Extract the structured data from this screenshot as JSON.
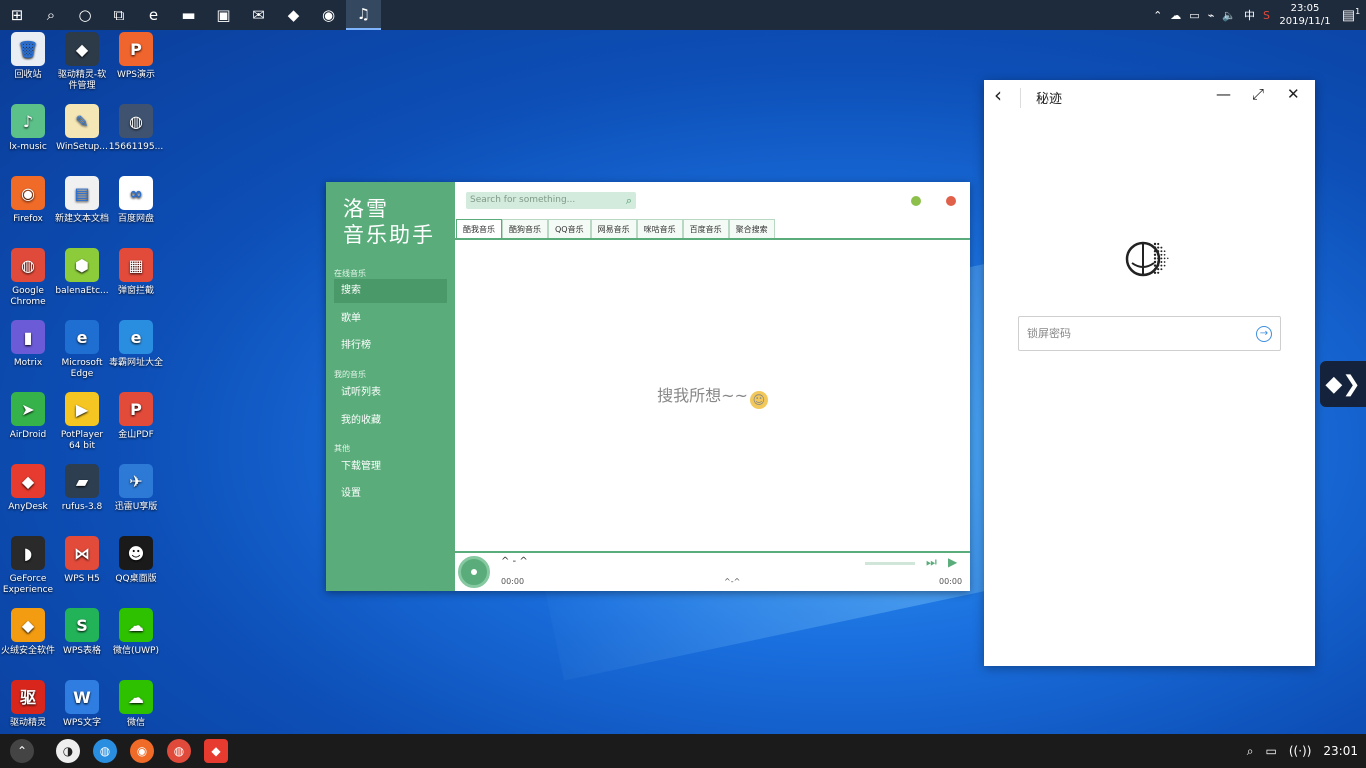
{
  "taskbar": {
    "buttons": [
      {
        "name": "start-icon",
        "glyph": "⊞"
      },
      {
        "name": "search-icon",
        "glyph": "⌕"
      },
      {
        "name": "cortana-icon",
        "glyph": "○"
      },
      {
        "name": "task-view-icon",
        "glyph": "⧉"
      },
      {
        "name": "edge-icon",
        "glyph": "e"
      },
      {
        "name": "file-explorer-icon",
        "glyph": "▬"
      },
      {
        "name": "store-icon",
        "glyph": "▣"
      },
      {
        "name": "mail-icon",
        "glyph": "✉"
      },
      {
        "name": "anydesk-icon",
        "glyph": "◆"
      },
      {
        "name": "firefox-icon",
        "glyph": "◉"
      },
      {
        "name": "luoxue-music-icon",
        "glyph": "♫"
      }
    ],
    "tray": {
      "ime": "中",
      "time": "23:05",
      "date": "2019/11/1",
      "notification_count": "1"
    }
  },
  "desktop_icons": [
    {
      "label": "回收站",
      "color": "#e9eef4",
      "glyph": "🗑",
      "col": 0,
      "row": 0
    },
    {
      "label": "驱动精灵-软件管理",
      "color": "#2d3a48",
      "glyph": "◆",
      "col": 1,
      "row": 0
    },
    {
      "label": "WPS演示",
      "color": "#f0642d",
      "glyph": "P",
      "col": 2,
      "row": 0
    },
    {
      "label": "lx-music",
      "color": "#5cc089",
      "glyph": "♪",
      "col": 0,
      "row": 1
    },
    {
      "label": "WinSetup...",
      "color": "#f4e6b5",
      "glyph": "✎",
      "col": 1,
      "row": 1
    },
    {
      "label": "15661195...",
      "color": "#3f5370",
      "glyph": "◍",
      "col": 2,
      "row": 1
    },
    {
      "label": "Firefox",
      "color": "#f06a28",
      "glyph": "◉",
      "col": 0,
      "row": 2
    },
    {
      "label": "新建文本文档",
      "color": "#f1f1f1",
      "glyph": "▤",
      "col": 1,
      "row": 2
    },
    {
      "label": "百度网盘",
      "color": "#ffffff",
      "glyph": "∞",
      "col": 2,
      "row": 2
    },
    {
      "label": "Google Chrome",
      "color": "#e04a3a",
      "glyph": "◍",
      "col": 0,
      "row": 3
    },
    {
      "label": "balenaEtc...",
      "color": "#8ccc3a",
      "glyph": "⬢",
      "col": 1,
      "row": 3
    },
    {
      "label": "弹窗拦截",
      "color": "#e24a3a",
      "glyph": "▦",
      "col": 2,
      "row": 3
    },
    {
      "label": "Motrix",
      "color": "#6c5bd6",
      "glyph": "▮",
      "col": 0,
      "row": 4
    },
    {
      "label": "Microsoft Edge",
      "color": "#1e6fd1",
      "glyph": "e",
      "col": 1,
      "row": 4
    },
    {
      "label": "毒霸网址大全",
      "color": "#2a8ee0",
      "glyph": "e",
      "col": 2,
      "row": 4
    },
    {
      "label": "AirDroid",
      "color": "#35b34a",
      "glyph": "➤",
      "col": 0,
      "row": 5
    },
    {
      "label": "PotPlayer 64 bit",
      "color": "#f5c521",
      "glyph": "▶",
      "col": 1,
      "row": 5
    },
    {
      "label": "金山PDF",
      "color": "#e24a3a",
      "glyph": "P",
      "col": 2,
      "row": 5
    },
    {
      "label": "AnyDesk",
      "color": "#e63b2e",
      "glyph": "◆",
      "col": 0,
      "row": 6
    },
    {
      "label": "rufus-3.8",
      "color": "#2c3e50",
      "glyph": "▰",
      "col": 1,
      "row": 6
    },
    {
      "label": "迅雷U享版",
      "color": "#2c7ad6",
      "glyph": "✈",
      "col": 2,
      "row": 6
    },
    {
      "label": "GeForce Experience",
      "color": "#2a2a2a",
      "glyph": "◗",
      "col": 0,
      "row": 7
    },
    {
      "label": "WPS H5",
      "color": "#e24a3a",
      "glyph": "⋈",
      "col": 1,
      "row": 7
    },
    {
      "label": "QQ桌面版",
      "color": "#1a1a1a",
      "glyph": "☻",
      "col": 2,
      "row": 7
    },
    {
      "label": "火绒安全软件",
      "color": "#f39c12",
      "glyph": "◆",
      "col": 0,
      "row": 8
    },
    {
      "label": "WPS表格",
      "color": "#22b358",
      "glyph": "S",
      "col": 1,
      "row": 8
    },
    {
      "label": "微信(UWP)",
      "color": "#2dc100",
      "glyph": "☁",
      "col": 2,
      "row": 8
    },
    {
      "label": "驱动精灵",
      "color": "#d9261c",
      "glyph": "驱",
      "col": 0,
      "row": 9
    },
    {
      "label": "WPS文字",
      "color": "#2f7de1",
      "glyph": "W",
      "col": 1,
      "row": 9
    },
    {
      "label": "微信",
      "color": "#2dc100",
      "glyph": "☁",
      "col": 2,
      "row": 9
    }
  ],
  "music_app": {
    "logo_line1": "洛雪",
    "logo_line2": "音乐助手",
    "sections": {
      "online": "在线音乐",
      "mine": "我的音乐",
      "other": "其他"
    },
    "menu": {
      "search": "搜索",
      "playlist": "歌单",
      "charts": "排行榜",
      "listen": "试听列表",
      "favorites": "我的收藏",
      "downloads": "下载管理",
      "settings": "设置"
    },
    "search_placeholder": "Search for something...",
    "tabs": [
      "酷我音乐",
      "酷狗音乐",
      "QQ音乐",
      "网易音乐",
      "咪咕音乐",
      "百度音乐",
      "聚合搜索"
    ],
    "empty_text": "搜我所想~~",
    "player": {
      "title": "^ - ^",
      "time_start": "00:00",
      "time_mid": "^-^",
      "time_end": "00:00"
    }
  },
  "mizhi": {
    "title": "秘迹",
    "password_placeholder": "锁屏密码"
  },
  "bottom": {
    "time": "23:01"
  }
}
